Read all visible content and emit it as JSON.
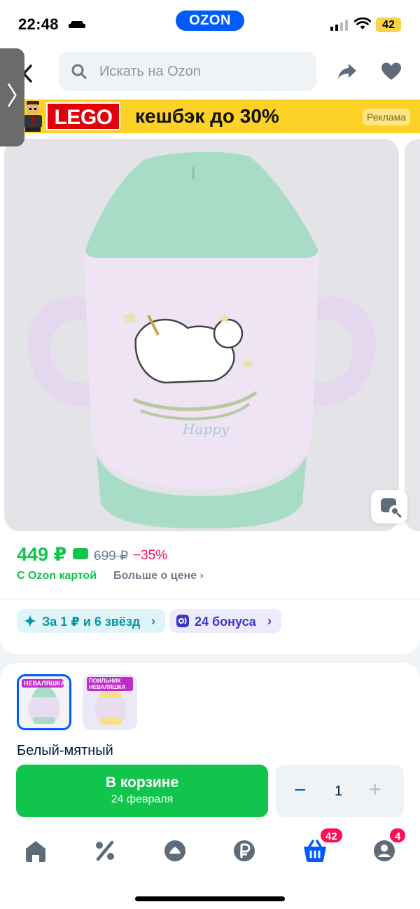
{
  "status_bar": {
    "time": "22:48",
    "brand": "OZON",
    "battery": "42"
  },
  "header": {
    "search_placeholder": "Искать на Ozon"
  },
  "ad_banner": {
    "brand": "LEGO",
    "text": "кешбэк до 30%",
    "tag": "Реклама"
  },
  "product": {
    "price": "449 ₽",
    "old_price": "699 ₽",
    "discount": "−35%",
    "ozon_card_label": "С Ozon картой",
    "more_about_price": "Больше о цене",
    "image_caption": "Happy"
  },
  "promos": {
    "stars_chip": "За 1 ₽ и 6 звёзд",
    "bonus_chip": "24 бонуса"
  },
  "variants": {
    "items": [
      {
        "label": "НЕВАЛЯШКА",
        "selected": true
      },
      {
        "label": "ПОИЛЬНИК НЕВАЛЯШКА",
        "selected": false
      }
    ],
    "selected_name": "Белый-мятный"
  },
  "action": {
    "cart_label": "В корзине",
    "delivery_date": "24 февраля",
    "quantity": "1",
    "minus": "−",
    "plus": "+"
  },
  "tabbar": {
    "items": [
      "home-icon",
      "percent-icon",
      "fresh-icon",
      "ruble-icon",
      "cart-icon",
      "profile-icon"
    ],
    "cart_badge": "42",
    "profile_badge": "4"
  },
  "colors": {
    "accent": "#005bff",
    "green": "#10c44c",
    "red": "#f91155",
    "mint": "#a8dcc6",
    "cup": "#e9dcef"
  }
}
